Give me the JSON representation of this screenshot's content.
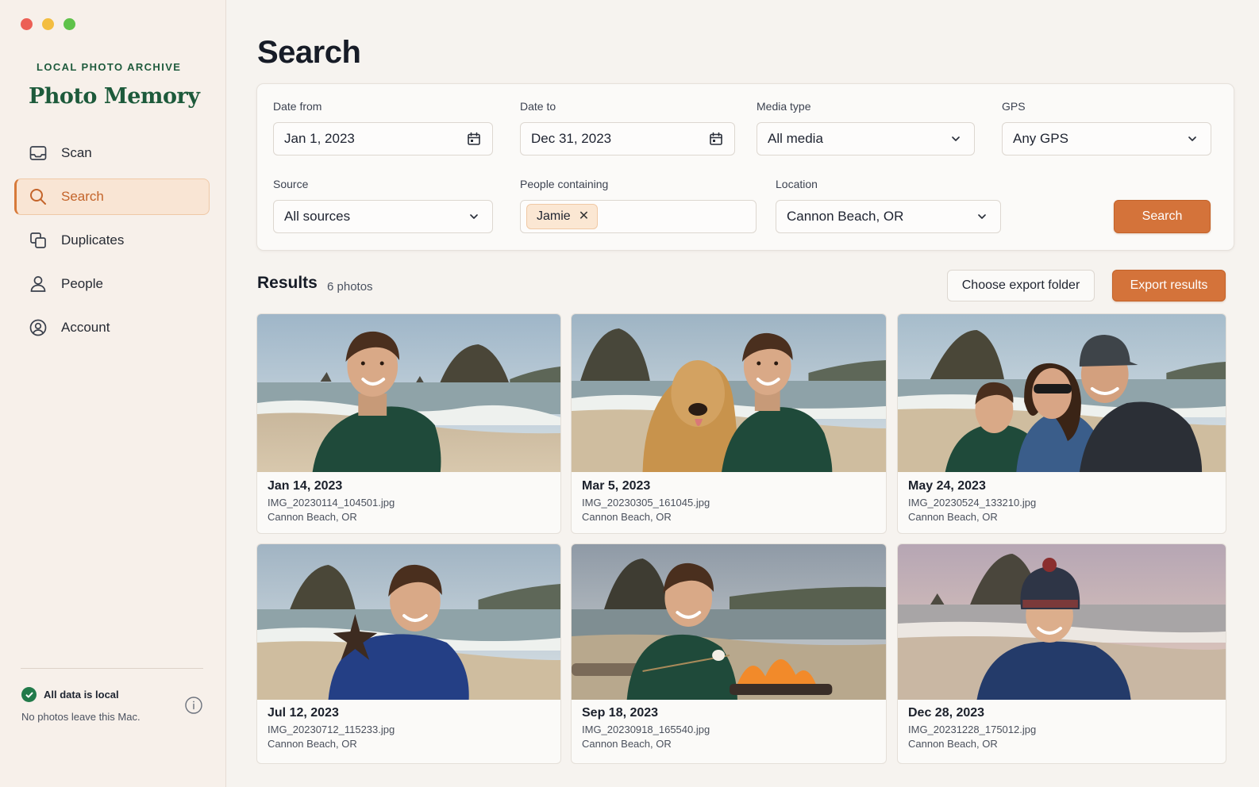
{
  "window": {
    "controls": [
      "close",
      "minimize",
      "zoom"
    ]
  },
  "sidebar": {
    "brand_sub": "LOCAL PHOTO ARCHIVE",
    "brand_title": "Photo Memory",
    "items": [
      {
        "label": "Scan",
        "icon": "tray-icon",
        "active": false
      },
      {
        "label": "Search",
        "icon": "search-icon",
        "active": true
      },
      {
        "label": "Duplicates",
        "icon": "duplicates-icon",
        "active": false
      },
      {
        "label": "People",
        "icon": "person-icon",
        "active": false
      },
      {
        "label": "Account",
        "icon": "account-icon",
        "active": false
      }
    ],
    "status": {
      "title": "All data is local",
      "description": "No photos leave this Mac."
    }
  },
  "main": {
    "title": "Search",
    "filters": {
      "date_from": {
        "label": "Date from",
        "value": "Jan 1, 2023"
      },
      "date_to": {
        "label": "Date to",
        "value": "Dec 31, 2023"
      },
      "media_type": {
        "label": "Media type",
        "value": "All media"
      },
      "gps": {
        "label": "GPS",
        "value": "Any GPS"
      },
      "source": {
        "label": "Source",
        "value": "All sources"
      },
      "people": {
        "label": "People containing",
        "chips": [
          "Jamie"
        ]
      },
      "location": {
        "label": "Location",
        "value": "Cannon Beach, OR"
      },
      "search_button": "Search"
    },
    "results": {
      "title": "Results",
      "count": "6 photos",
      "choose_folder_button": "Choose export folder",
      "export_button": "Export results",
      "photos": [
        {
          "date": "Jan 14, 2023",
          "file": "IMG_20230114_104501.jpg",
          "location": "Cannon Beach, OR"
        },
        {
          "date": "Mar 5, 2023",
          "file": "IMG_20230305_161045.jpg",
          "location": "Cannon Beach, OR"
        },
        {
          "date": "May 24, 2023",
          "file": "IMG_20230524_133210.jpg",
          "location": "Cannon Beach, OR"
        },
        {
          "date": "Jul 12, 2023",
          "file": "IMG_20230712_115233.jpg",
          "location": "Cannon Beach, OR"
        },
        {
          "date": "Sep 18, 2023",
          "file": "IMG_20230918_165540.jpg",
          "location": "Cannon Beach, OR"
        },
        {
          "date": "Dec 28, 2023",
          "file": "IMG_20231228_175012.jpg",
          "location": "Cannon Beach, OR"
        }
      ]
    }
  },
  "colors": {
    "accent": "#d4733a",
    "brand_green": "#1d5a3b",
    "sidebar_bg": "#f7f0ea",
    "active_bg": "#f9e5d4"
  }
}
